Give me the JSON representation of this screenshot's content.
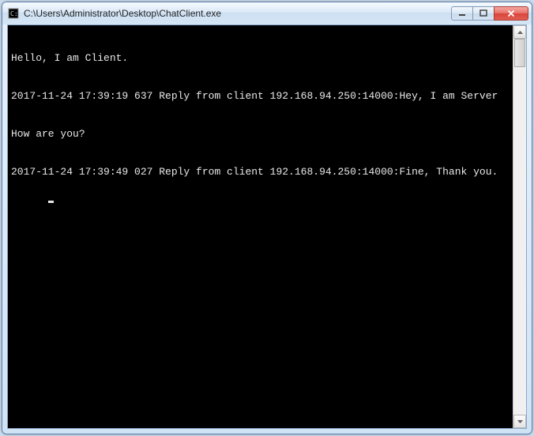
{
  "window": {
    "title": "C:\\Users\\Administrator\\Desktop\\ChatClient.exe"
  },
  "console": {
    "lines": [
      "Hello, I am Client.",
      "2017-11-24 17:39:19 637 Reply from client 192.168.94.250:14000:Hey, I am Server",
      "How are you?",
      "2017-11-24 17:39:49 027 Reply from client 192.168.94.250:14000:Fine, Thank you."
    ]
  }
}
